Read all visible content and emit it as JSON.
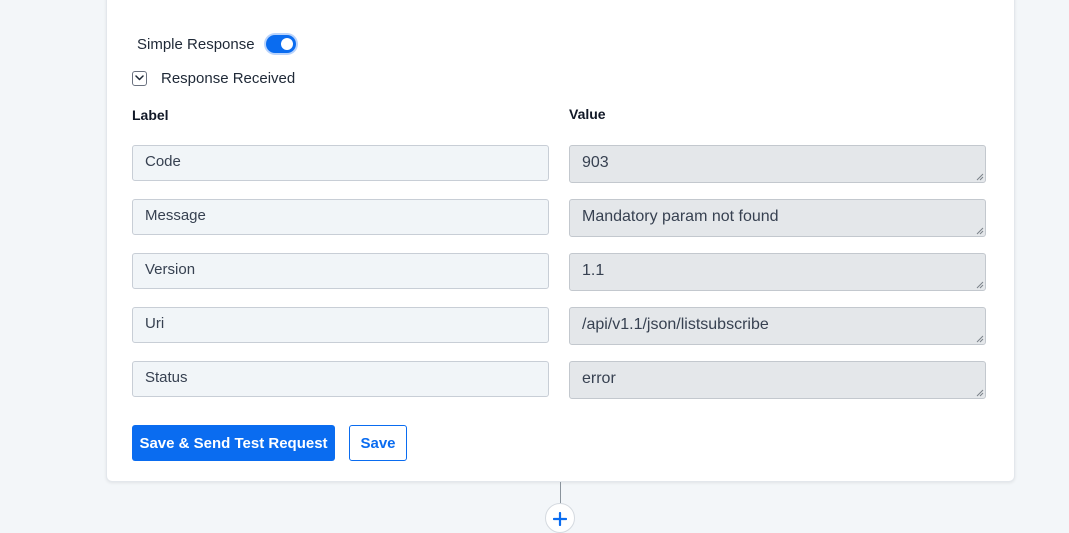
{
  "response_panel": {
    "simple_response_label": "Simple Response",
    "simple_response_enabled": true,
    "response_received_label": "Response Received",
    "label_column_header": "Label",
    "value_column_header": "Value",
    "rows": [
      {
        "label": "Code",
        "value": "903"
      },
      {
        "label": "Message",
        "value": "Mandatory param not found"
      },
      {
        "label": "Version",
        "value": "1.1"
      },
      {
        "label": "Uri",
        "value": "/api/v1.1/json/listsubscribe"
      },
      {
        "label": "Status",
        "value": "error"
      }
    ]
  },
  "actions": {
    "save_send_label": "Save & Send Test Request",
    "save_label": "Save"
  },
  "colors": {
    "primary": "#0a6cf0",
    "page_background": "#f3f6f9",
    "label_field_bg": "#f1f5f8",
    "value_field_bg": "#e4e7ea"
  },
  "icons": {
    "toggle": "toggle-switch-icon",
    "collapse": "chevron-down-icon",
    "add_step": "plus-icon",
    "resize": "resize-grip-icon"
  }
}
